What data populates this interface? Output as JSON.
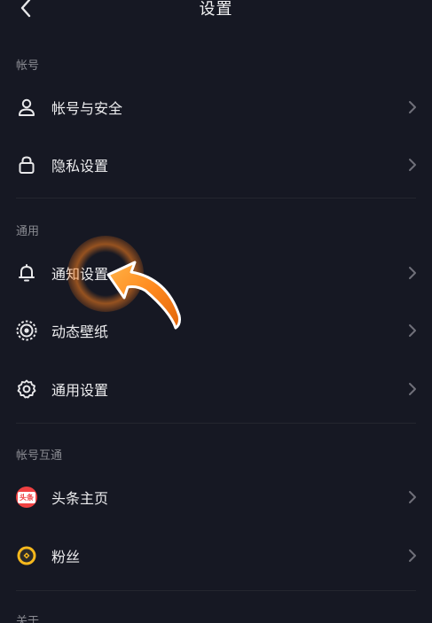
{
  "header": {
    "title": "设置"
  },
  "sections": [
    {
      "label": "帐号",
      "items": [
        {
          "label": "帐号与安全",
          "icon": "user-icon"
        },
        {
          "label": "隐私设置",
          "icon": "lock-icon"
        }
      ]
    },
    {
      "label": "通用",
      "items": [
        {
          "label": "通知设置",
          "icon": "bell-icon"
        },
        {
          "label": "动态壁纸",
          "icon": "wallpaper-icon"
        },
        {
          "label": "通用设置",
          "icon": "gear-icon"
        }
      ]
    },
    {
      "label": "帐号互通",
      "items": [
        {
          "label": "头条主页",
          "icon": "toutiao-logo-icon",
          "badge": "头条"
        },
        {
          "label": "粉丝",
          "icon": "fans-icon"
        }
      ]
    },
    {
      "label": "关于"
    }
  ],
  "colors": {
    "background": "#161823",
    "text": "#ececee",
    "muted": "#8a8b92",
    "highlight": "#ff8a1f"
  }
}
